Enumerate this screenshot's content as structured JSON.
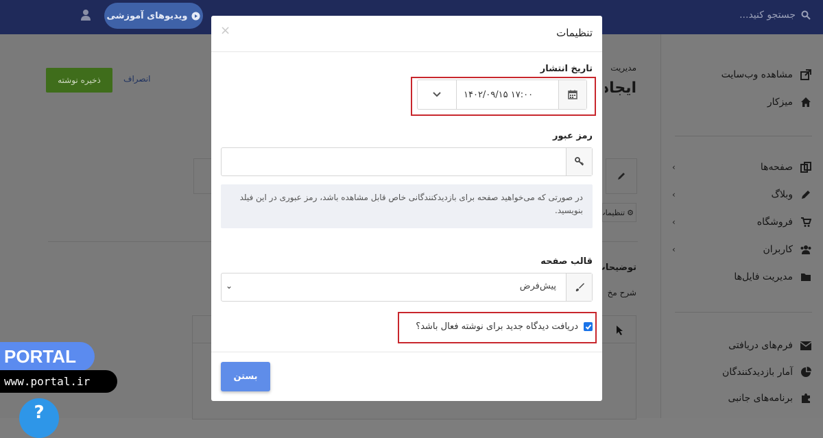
{
  "topbar": {
    "search_placeholder": "جستجو کنید...",
    "video_button": "ویدیوهای آموزشی"
  },
  "sidebar": {
    "items_top": [
      {
        "label": "مشاهده وب‌سایت",
        "icon": "external-link-icon"
      },
      {
        "label": "میزکار",
        "icon": "home-icon"
      }
    ],
    "items_main": [
      {
        "label": "صفحه‌ها",
        "icon": "pages-icon"
      },
      {
        "label": "وبلاگ",
        "icon": "pencil-icon"
      },
      {
        "label": "فروشگاه",
        "icon": "cart-icon"
      },
      {
        "label": "کاربران",
        "icon": "users-icon"
      },
      {
        "label": "مدیریت فایل‌ها",
        "icon": "folder-icon"
      }
    ],
    "items_bottom": [
      {
        "label": "فرم‌های دریافتی",
        "icon": "envelope-icon"
      },
      {
        "label": "آمار بازدیدکنندگان",
        "icon": "pie-chart-icon"
      },
      {
        "label": "برنامه‌های جانبی",
        "icon": "puzzle-icon"
      }
    ]
  },
  "background": {
    "save_button": "ذخیره نوشته",
    "cancel_link": "انصراف",
    "breadcrumb": "مدیریت",
    "heading_fragment": "ایجاد",
    "settings_fragment": "تنظیمات",
    "desc_label_fragment": "توضیحات",
    "desc_sub_fragment": "شرح مخ"
  },
  "modal": {
    "title": "تنظیمات",
    "close_symbol": "×",
    "publish_date_label": "تاریخ انتشار",
    "publish_date_value": "۱۴۰۲/۰۹/۱۵ ۱۷:۰۰",
    "password_label": "رمز عبور",
    "password_value": "",
    "password_help": "در صورتی که می‌خواهید صفحه برای بازدیدکنندگانی خاص قابل مشاهده باشد، رمز عبوری در این فیلد بنویسید.",
    "template_label": "قالب صفحه",
    "template_value": "پیش‌فرض",
    "comments_checkbox_label": "دریافت دیدگاه جدید برای نوشته فعال باشد؟",
    "comments_checked": true,
    "close_button": "بستن"
  },
  "branding": {
    "portal_label": "PORTAL",
    "portal_url": "www.portal.ir",
    "help_symbol": "?"
  },
  "colors": {
    "topbar": "#1f2a5a",
    "primary_button": "#5f8de9",
    "highlight_border": "#c8262c",
    "save_button": "#3f6d1b"
  }
}
